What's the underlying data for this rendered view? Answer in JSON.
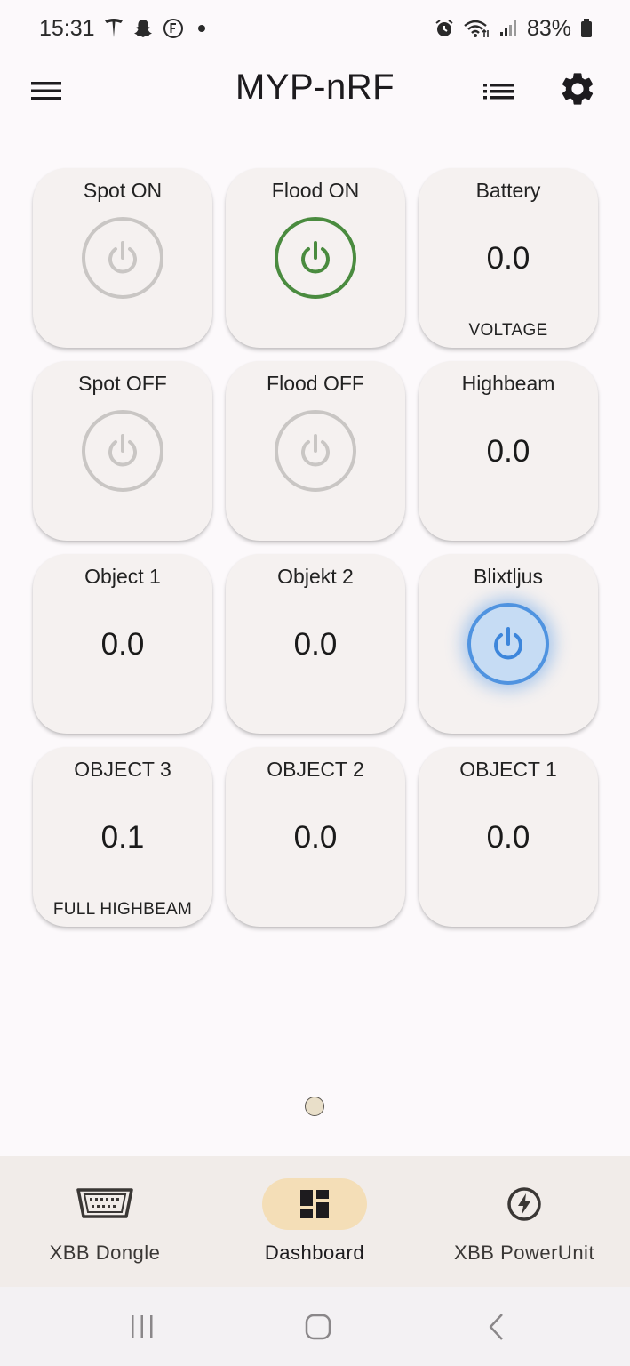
{
  "status_bar": {
    "time": "15:31",
    "left_icons": [
      "tesla-icon",
      "snapchat-icon",
      "f-circle-icon",
      "dot-icon"
    ],
    "right_icons": [
      "alarm-icon",
      "wifi-icon",
      "signal-icon"
    ],
    "battery": "83%"
  },
  "app_bar": {
    "title": "MYP-nRF",
    "icons": [
      "menu-icon",
      "list-icon",
      "gear-icon"
    ]
  },
  "tiles": [
    {
      "title": "Spot ON",
      "kind": "power",
      "state": "off"
    },
    {
      "title": "Flood ON",
      "kind": "power",
      "state": "on",
      "color": "#4a8b3f"
    },
    {
      "title": "Battery",
      "kind": "value",
      "value": "0.0",
      "subtitle": "VOLTAGE"
    },
    {
      "title": "Spot OFF",
      "kind": "power",
      "state": "off"
    },
    {
      "title": "Flood OFF",
      "kind": "power",
      "state": "off"
    },
    {
      "title": "Highbeam",
      "kind": "value",
      "value": "0.0"
    },
    {
      "title": "Object 1",
      "kind": "value",
      "value": "0.0"
    },
    {
      "title": "Objekt 2",
      "kind": "value",
      "value": "0.0"
    },
    {
      "title": "Blixtljus",
      "kind": "power",
      "state": "on",
      "color": "#4f93e0"
    },
    {
      "title": "OBJECT 3",
      "kind": "value",
      "value": "0.1",
      "subtitle": "FULL HIGHBEAM"
    },
    {
      "title": "OBJECT 2",
      "kind": "value",
      "value": "0.0"
    },
    {
      "title": "OBJECT 1",
      "kind": "value",
      "value": "0.0"
    }
  ],
  "bottom_nav": {
    "items": [
      {
        "label": "XBB Dongle",
        "icon": "obd-connector-icon",
        "active": false
      },
      {
        "label": "Dashboard",
        "icon": "dashboard-icon",
        "active": true
      },
      {
        "label": "XBB PowerUnit",
        "icon": "power-bolt-icon",
        "active": false
      }
    ],
    "active_color": "#f4deb7"
  },
  "system_nav": [
    "recents-icon",
    "home-icon",
    "back-icon"
  ]
}
